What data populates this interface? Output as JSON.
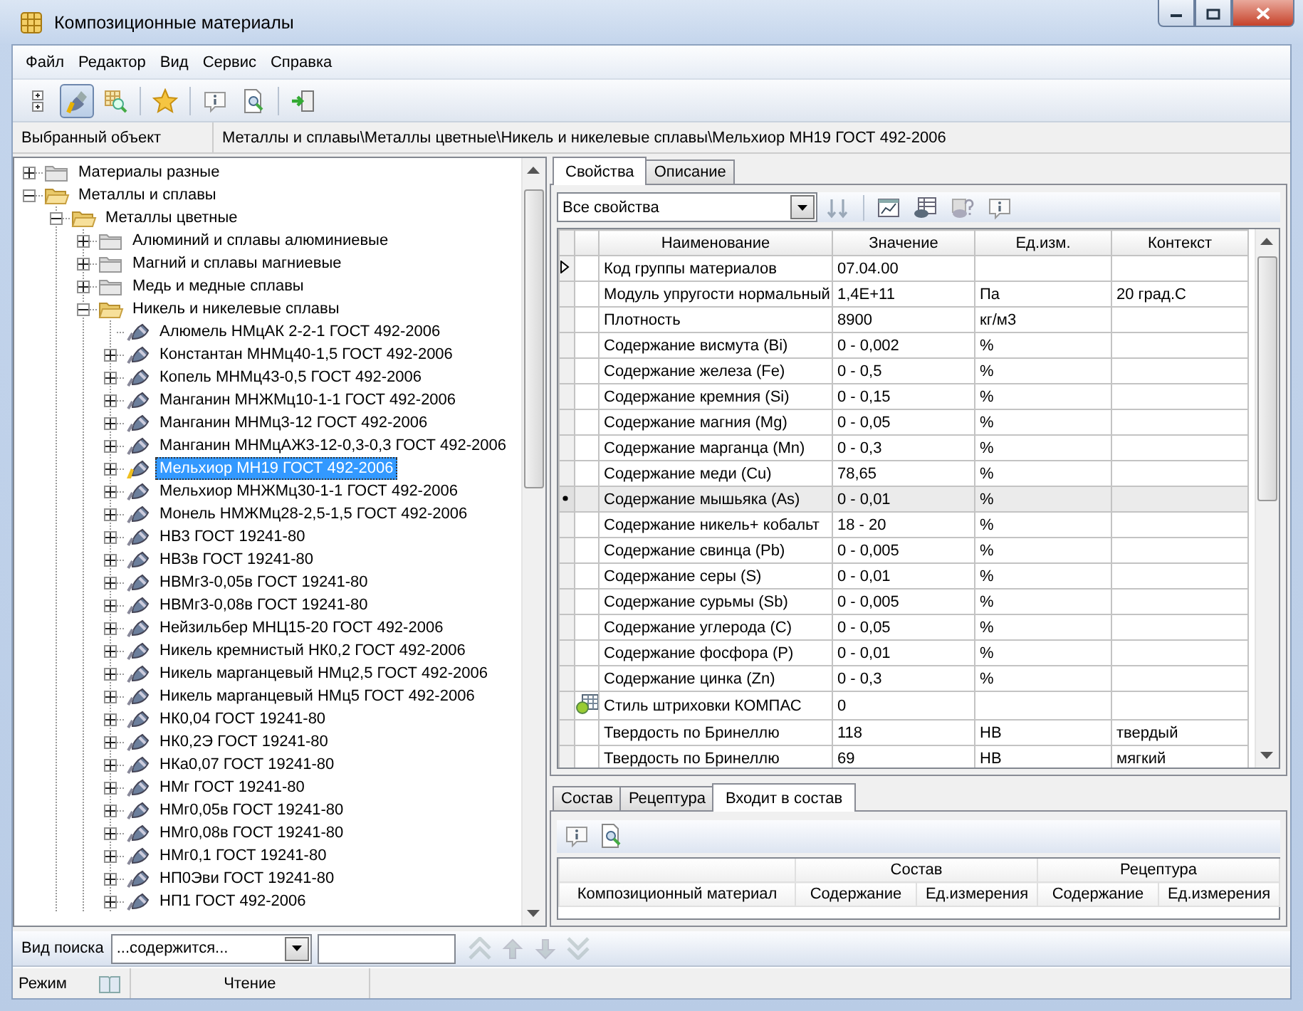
{
  "window": {
    "title": "Композиционные материалы"
  },
  "menu": [
    {
      "label": "Файл"
    },
    {
      "label": "Редактор"
    },
    {
      "label": "Вид"
    },
    {
      "label": "Сервис"
    },
    {
      "label": "Справка"
    }
  ],
  "toolbar": [
    {
      "kind": "tree",
      "pressed": false
    },
    {
      "kind": "paint",
      "pressed": true
    },
    {
      "kind": "grid-search",
      "pressed": false
    },
    {
      "kind": "separator"
    },
    {
      "kind": "star",
      "pressed": false
    },
    {
      "kind": "separator"
    },
    {
      "kind": "info",
      "pressed": false
    },
    {
      "kind": "preview",
      "pressed": false
    },
    {
      "kind": "separator"
    },
    {
      "kind": "exit",
      "pressed": false
    }
  ],
  "selected_object": {
    "label": "Выбранный объект",
    "path": "Металлы и сплавы\\Металлы цветные\\Никель и никелевые сплавы\\Мельхиор МН19 ГОСТ 492-2006"
  },
  "tree": [
    {
      "label": "Материалы разные",
      "kind": "folder",
      "expandable": true,
      "expanded": false,
      "selected": false
    },
    {
      "label": "Металлы и сплавы",
      "kind": "folder",
      "expandable": true,
      "expanded": true,
      "selected": false,
      "children": [
        {
          "label": "Металлы цветные",
          "kind": "folder",
          "expandable": true,
          "expanded": true,
          "selected": false,
          "children": [
            {
              "label": "Алюминий и сплавы алюминиевые",
              "kind": "folder",
              "expandable": true,
              "expanded": false,
              "selected": false
            },
            {
              "label": "Магний и сплавы магниевые",
              "kind": "folder",
              "expandable": true,
              "expanded": false,
              "selected": false
            },
            {
              "label": "Медь и медные сплавы",
              "kind": "folder",
              "expandable": true,
              "expanded": false,
              "selected": false
            },
            {
              "label": "Никель и никелевые сплавы",
              "kind": "folder",
              "expandable": true,
              "expanded": true,
              "selected": false,
              "children": [
                {
                  "label": "Алюмель НМцАК 2-2-1 ГОСТ 492-2006",
                  "kind": "material",
                  "expandable": false,
                  "selected": false
                },
                {
                  "label": "Константан МНМц40-1,5 ГОСТ 492-2006",
                  "kind": "material",
                  "expandable": true,
                  "expanded": false,
                  "selected": false
                },
                {
                  "label": "Копель МНМц43-0,5 ГОСТ 492-2006",
                  "kind": "material",
                  "expandable": true,
                  "expanded": false,
                  "selected": false
                },
                {
                  "label": "Манганин МНЖМц10-1-1 ГОСТ 492-2006",
                  "kind": "material",
                  "expandable": true,
                  "expanded": false,
                  "selected": false
                },
                {
                  "label": "Манганин МНМц3-12 ГОСТ 492-2006",
                  "kind": "material",
                  "expandable": true,
                  "expanded": false,
                  "selected": false
                },
                {
                  "label": "Манганин МНМцАЖ3-12-0,3-0,3 ГОСТ 492-2006",
                  "kind": "material",
                  "expandable": true,
                  "expanded": false,
                  "selected": false
                },
                {
                  "label": "Мельхиор МН19 ГОСТ 492-2006",
                  "kind": "material",
                  "expandable": true,
                  "expanded": false,
                  "selected": true
                },
                {
                  "label": "Мельхиор МНЖМц30-1-1 ГОСТ 492-2006",
                  "kind": "material",
                  "expandable": true,
                  "expanded": false,
                  "selected": false
                },
                {
                  "label": "Монель НМЖМц28-2,5-1,5 ГОСТ 492-2006",
                  "kind": "material",
                  "expandable": true,
                  "expanded": false,
                  "selected": false
                },
                {
                  "label": "НВ3 ГОСТ 19241-80",
                  "kind": "material",
                  "expandable": true,
                  "expanded": false,
                  "selected": false
                },
                {
                  "label": "НВ3в ГОСТ 19241-80",
                  "kind": "material",
                  "expandable": true,
                  "expanded": false,
                  "selected": false
                },
                {
                  "label": "НВМг3-0,05в ГОСТ 19241-80",
                  "kind": "material",
                  "expandable": true,
                  "expanded": false,
                  "selected": false
                },
                {
                  "label": "НВМг3-0,08в ГОСТ 19241-80",
                  "kind": "material",
                  "expandable": true,
                  "expanded": false,
                  "selected": false
                },
                {
                  "label": "Нейзильбер МНЦ15-20 ГОСТ 492-2006",
                  "kind": "material",
                  "expandable": true,
                  "expanded": false,
                  "selected": false
                },
                {
                  "label": "Никель кремнистый НК0,2 ГОСТ 492-2006",
                  "kind": "material",
                  "expandable": true,
                  "expanded": false,
                  "selected": false
                },
                {
                  "label": "Никель марганцевый НМц2,5 ГОСТ 492-2006",
                  "kind": "material",
                  "expandable": true,
                  "expanded": false,
                  "selected": false
                },
                {
                  "label": "Никель марганцевый НМц5 ГОСТ 492-2006",
                  "kind": "material",
                  "expandable": true,
                  "expanded": false,
                  "selected": false
                },
                {
                  "label": "НК0,04 ГОСТ 19241-80",
                  "kind": "material",
                  "expandable": true,
                  "expanded": false,
                  "selected": false
                },
                {
                  "label": "НК0,2Э ГОСТ 19241-80",
                  "kind": "material",
                  "expandable": true,
                  "expanded": false,
                  "selected": false
                },
                {
                  "label": "НКа0,07 ГОСТ 19241-80",
                  "kind": "material",
                  "expandable": true,
                  "expanded": false,
                  "selected": false
                },
                {
                  "label": "НМг ГОСТ 19241-80",
                  "kind": "material",
                  "expandable": true,
                  "expanded": false,
                  "selected": false
                },
                {
                  "label": "НМг0,05в ГОСТ 19241-80",
                  "kind": "material",
                  "expandable": true,
                  "expanded": false,
                  "selected": false
                },
                {
                  "label": "НМг0,08в ГОСТ 19241-80",
                  "kind": "material",
                  "expandable": true,
                  "expanded": false,
                  "selected": false
                },
                {
                  "label": "НМг0,1 ГОСТ 19241-80",
                  "kind": "material",
                  "expandable": true,
                  "expanded": false,
                  "selected": false
                },
                {
                  "label": "НП0Эви ГОСТ 19241-80",
                  "kind": "material",
                  "expandable": true,
                  "expanded": false,
                  "selected": false
                },
                {
                  "label": "НП1 ГОСТ 492-2006",
                  "kind": "material",
                  "expandable": true,
                  "expanded": false,
                  "selected": false
                }
              ]
            }
          ]
        }
      ]
    }
  ],
  "properties": {
    "tabs": [
      {
        "label": "Свойства",
        "selected": true
      },
      {
        "label": "Описание",
        "selected": false
      }
    ],
    "filter": {
      "value": "Все свойства"
    },
    "toolbar": [
      {
        "kind": "sort"
      },
      {
        "kind": "separator"
      },
      {
        "kind": "chart"
      },
      {
        "kind": "table-export"
      },
      {
        "kind": "help"
      },
      {
        "kind": "info"
      }
    ],
    "columns": [
      "Наименование",
      "Значение",
      "Ед.изм.",
      "Контекст"
    ],
    "rows": [
      {
        "current": true,
        "selected": false,
        "name": "Код группы материалов",
        "value": "07.04.00",
        "unit": "",
        "context": ""
      },
      {
        "current": false,
        "selected": false,
        "name": "Модуль упругости нормальный",
        "value": "1,4E+11",
        "unit": "Па",
        "context": "20 град.С"
      },
      {
        "current": false,
        "selected": false,
        "name": "Плотность",
        "value": "8900",
        "unit": "кг/м3",
        "context": ""
      },
      {
        "current": false,
        "selected": false,
        "name": "Содержание висмута (Bi)",
        "value": "0 - 0,002",
        "unit": "%",
        "context": ""
      },
      {
        "current": false,
        "selected": false,
        "name": "Содержание железа (Fe)",
        "value": "0 - 0,5",
        "unit": "%",
        "context": ""
      },
      {
        "current": false,
        "selected": false,
        "name": "Содержание кремния (Si)",
        "value": "0 - 0,15",
        "unit": "%",
        "context": ""
      },
      {
        "current": false,
        "selected": false,
        "name": "Содержание магния (Mg)",
        "value": "0 - 0,05",
        "unit": "%",
        "context": ""
      },
      {
        "current": false,
        "selected": false,
        "name": "Содержание марганца (Mn)",
        "value": "0 - 0,3",
        "unit": "%",
        "context": ""
      },
      {
        "current": false,
        "selected": false,
        "name": "Содержание меди (Cu)",
        "value": "78,65",
        "unit": "%",
        "context": ""
      },
      {
        "current": false,
        "selected": true,
        "name": "Содержание мышьяка (As)",
        "value": "0 - 0,01",
        "unit": "%",
        "context": ""
      },
      {
        "current": false,
        "selected": false,
        "name": "Содержание никель+ кобальт",
        "value": "18 - 20",
        "unit": "%",
        "context": ""
      },
      {
        "current": false,
        "selected": false,
        "name": "Содержание свинца (Pb)",
        "value": "0 - 0,005",
        "unit": "%",
        "context": ""
      },
      {
        "current": false,
        "selected": false,
        "name": "Содержание серы (S)",
        "value": "0 - 0,01",
        "unit": "%",
        "context": ""
      },
      {
        "current": false,
        "selected": false,
        "name": "Содержание сурьмы (Sb)",
        "value": "0 - 0,005",
        "unit": "%",
        "context": ""
      },
      {
        "current": false,
        "selected": false,
        "name": "Содержание углерода (C)",
        "value": "0 - 0,05",
        "unit": "%",
        "context": ""
      },
      {
        "current": false,
        "selected": false,
        "name": "Содержание фосфора (P)",
        "value": "0 - 0,01",
        "unit": "%",
        "context": ""
      },
      {
        "current": false,
        "selected": false,
        "name": "Содержание цинка (Zn)",
        "value": "0 - 0,3",
        "unit": "%",
        "context": ""
      },
      {
        "current": false,
        "selected": false,
        "kind": "hatch-style",
        "name": "Стиль штриховки КОМПАС",
        "value": "0",
        "unit": "",
        "context": ""
      },
      {
        "current": false,
        "selected": false,
        "name": "Твердость по Бринеллю",
        "value": "118",
        "unit": "HB",
        "context": "твердый"
      },
      {
        "current": false,
        "selected": false,
        "name": "Твердость по Бринеллю",
        "value": "69",
        "unit": "HB",
        "context": "мягкий"
      }
    ]
  },
  "relations": {
    "tabs": [
      {
        "label": "Состав",
        "selected": false
      },
      {
        "label": "Рецептура",
        "selected": false
      },
      {
        "label": "Входит в состав",
        "selected": true
      }
    ],
    "toolbar": [
      {
        "kind": "info"
      },
      {
        "kind": "preview"
      }
    ],
    "first_column": "Композиционный материал",
    "groups": [
      {
        "label": "Состав",
        "columns": [
          "Содержание",
          "Ед.измерения"
        ]
      },
      {
        "label": "Рецептура",
        "columns": [
          "Содержание",
          "Ед.измерения"
        ]
      }
    ]
  },
  "search": {
    "label": "Вид поиска",
    "mode": "...содержится...",
    "nav_buttons": [
      {
        "kind": "top",
        "disabled": true
      },
      {
        "kind": "up",
        "disabled": true
      },
      {
        "kind": "down",
        "disabled": true
      },
      {
        "kind": "bottom",
        "disabled": true
      }
    ]
  },
  "status_bar": {
    "label": "Режим",
    "mode": "Чтение"
  }
}
